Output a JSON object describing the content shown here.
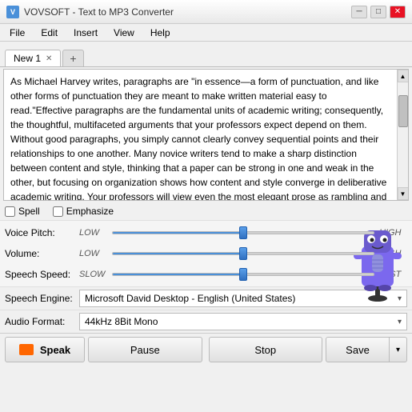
{
  "titleBar": {
    "icon": "V",
    "title": "VOVSOFT - Text to MP3 Converter",
    "minimizeBtn": "─",
    "maximizeBtn": "□",
    "closeBtn": "✕"
  },
  "menuBar": {
    "items": [
      "File",
      "Edit",
      "Insert",
      "View",
      "Help"
    ]
  },
  "tabs": {
    "activeTab": "New 1",
    "addLabel": "+"
  },
  "textArea": {
    "content": "As Michael Harvey writes, paragraphs are \"in essence—a form of punctuation, and like other forms of punctuation they are meant to make written material easy to read.\"Effective paragraphs are the fundamental units of academic writing; consequently, the thoughtful, multifaceted arguments that your professors expect depend on them. Without good paragraphs, you simply cannot clearly convey sequential points and their relationships to one another.\n\nMany novice writers tend to make a sharp distinction between content and style, thinking that a paper can be strong in one and weak in the other, but focusing on organization shows how content and style converge in deliberative academic writing. Your professors will view even the most elegant prose as rambling and"
  },
  "checkboxes": {
    "spell": {
      "label": "Spell",
      "checked": false
    },
    "emphasize": {
      "label": "Emphasize",
      "checked": false
    }
  },
  "sliders": {
    "voicePitch": {
      "label": "Voice Pitch:",
      "leftLabel": "LOW",
      "rightLabel": "HIGH",
      "value": 50
    },
    "volume": {
      "label": "Volume:",
      "leftLabel": "LOW",
      "rightLabel": "HIGH",
      "value": 50
    },
    "speechSpeed": {
      "label": "Speech Speed:",
      "leftLabel": "SLOW",
      "rightLabel": "FAST",
      "value": 50
    }
  },
  "dropdowns": {
    "speechEngine": {
      "label": "Speech Engine:",
      "value": "Microsoft David Desktop - English (United States)"
    },
    "audioFormat": {
      "label": "Audio Format:",
      "value": "44kHz 8Bit Mono"
    }
  },
  "buttons": {
    "speak": "Speak",
    "pause": "Pause",
    "stop": "Stop",
    "save": "Save"
  }
}
